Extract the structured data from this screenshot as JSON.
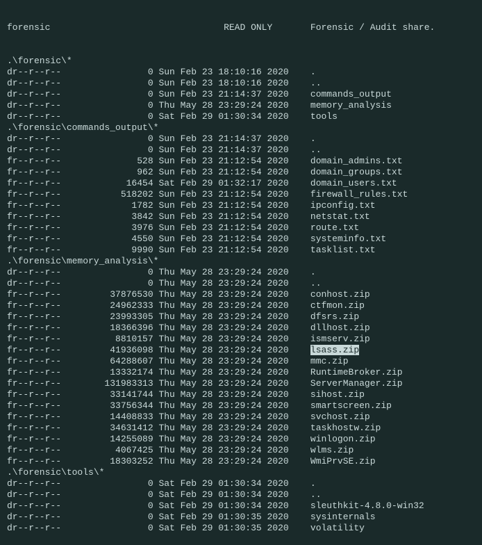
{
  "share": {
    "name": "forensic",
    "permission": "READ ONLY",
    "description": "Forensic / Audit share."
  },
  "sections": [
    {
      "path": ".\\forensic\\*",
      "rows": [
        {
          "perms": "dr--r--r--",
          "size": "0",
          "date": "Sun Feb 23 18:10:16 2020",
          "name": "."
        },
        {
          "perms": "dr--r--r--",
          "size": "0",
          "date": "Sun Feb 23 18:10:16 2020",
          "name": ".."
        },
        {
          "perms": "dr--r--r--",
          "size": "0",
          "date": "Sun Feb 23 21:14:37 2020",
          "name": "commands_output"
        },
        {
          "perms": "dr--r--r--",
          "size": "0",
          "date": "Thu May 28 23:29:24 2020",
          "name": "memory_analysis"
        },
        {
          "perms": "dr--r--r--",
          "size": "0",
          "date": "Sat Feb 29 01:30:34 2020",
          "name": "tools"
        }
      ]
    },
    {
      "path": ".\\forensic\\commands_output\\*",
      "rows": [
        {
          "perms": "dr--r--r--",
          "size": "0",
          "date": "Sun Feb 23 21:14:37 2020",
          "name": "."
        },
        {
          "perms": "dr--r--r--",
          "size": "0",
          "date": "Sun Feb 23 21:14:37 2020",
          "name": ".."
        },
        {
          "perms": "fr--r--r--",
          "size": "528",
          "date": "Sun Feb 23 21:12:54 2020",
          "name": "domain_admins.txt"
        },
        {
          "perms": "fr--r--r--",
          "size": "962",
          "date": "Sun Feb 23 21:12:54 2020",
          "name": "domain_groups.txt"
        },
        {
          "perms": "fr--r--r--",
          "size": "16454",
          "date": "Sat Feb 29 01:32:17 2020",
          "name": "domain_users.txt"
        },
        {
          "perms": "fr--r--r--",
          "size": "518202",
          "date": "Sun Feb 23 21:12:54 2020",
          "name": "firewall_rules.txt"
        },
        {
          "perms": "fr--r--r--",
          "size": "1782",
          "date": "Sun Feb 23 21:12:54 2020",
          "name": "ipconfig.txt"
        },
        {
          "perms": "fr--r--r--",
          "size": "3842",
          "date": "Sun Feb 23 21:12:54 2020",
          "name": "netstat.txt"
        },
        {
          "perms": "fr--r--r--",
          "size": "3976",
          "date": "Sun Feb 23 21:12:54 2020",
          "name": "route.txt"
        },
        {
          "perms": "fr--r--r--",
          "size": "4550",
          "date": "Sun Feb 23 21:12:54 2020",
          "name": "systeminfo.txt"
        },
        {
          "perms": "fr--r--r--",
          "size": "9990",
          "date": "Sun Feb 23 21:12:54 2020",
          "name": "tasklist.txt"
        }
      ]
    },
    {
      "path": ".\\forensic\\memory_analysis\\*",
      "rows": [
        {
          "perms": "dr--r--r--",
          "size": "0",
          "date": "Thu May 28 23:29:24 2020",
          "name": "."
        },
        {
          "perms": "dr--r--r--",
          "size": "0",
          "date": "Thu May 28 23:29:24 2020",
          "name": ".."
        },
        {
          "perms": "fr--r--r--",
          "size": "37876530",
          "date": "Thu May 28 23:29:24 2020",
          "name": "conhost.zip"
        },
        {
          "perms": "fr--r--r--",
          "size": "24962333",
          "date": "Thu May 28 23:29:24 2020",
          "name": "ctfmon.zip"
        },
        {
          "perms": "fr--r--r--",
          "size": "23993305",
          "date": "Thu May 28 23:29:24 2020",
          "name": "dfsrs.zip"
        },
        {
          "perms": "fr--r--r--",
          "size": "18366396",
          "date": "Thu May 28 23:29:24 2020",
          "name": "dllhost.zip"
        },
        {
          "perms": "fr--r--r--",
          "size": "8810157",
          "date": "Thu May 28 23:29:24 2020",
          "name": "ismserv.zip"
        },
        {
          "perms": "fr--r--r--",
          "size": "41936098",
          "date": "Thu May 28 23:29:24 2020",
          "name": "lsass.zip",
          "highlight": true
        },
        {
          "perms": "fr--r--r--",
          "size": "64288607",
          "date": "Thu May 28 23:29:24 2020",
          "name": "mmc.zip"
        },
        {
          "perms": "fr--r--r--",
          "size": "13332174",
          "date": "Thu May 28 23:29:24 2020",
          "name": "RuntimeBroker.zip"
        },
        {
          "perms": "fr--r--r--",
          "size": "131983313",
          "date": "Thu May 28 23:29:24 2020",
          "name": "ServerManager.zip"
        },
        {
          "perms": "fr--r--r--",
          "size": "33141744",
          "date": "Thu May 28 23:29:24 2020",
          "name": "sihost.zip"
        },
        {
          "perms": "fr--r--r--",
          "size": "33756344",
          "date": "Thu May 28 23:29:24 2020",
          "name": "smartscreen.zip"
        },
        {
          "perms": "fr--r--r--",
          "size": "14408833",
          "date": "Thu May 28 23:29:24 2020",
          "name": "svchost.zip"
        },
        {
          "perms": "fr--r--r--",
          "size": "34631412",
          "date": "Thu May 28 23:29:24 2020",
          "name": "taskhostw.zip"
        },
        {
          "perms": "fr--r--r--",
          "size": "14255089",
          "date": "Thu May 28 23:29:24 2020",
          "name": "winlogon.zip"
        },
        {
          "perms": "fr--r--r--",
          "size": "4067425",
          "date": "Thu May 28 23:29:24 2020",
          "name": "wlms.zip"
        },
        {
          "perms": "fr--r--r--",
          "size": "18303252",
          "date": "Thu May 28 23:29:24 2020",
          "name": "WmiPrvSE.zip"
        }
      ]
    },
    {
      "path": ".\\forensic\\tools\\*",
      "rows": [
        {
          "perms": "dr--r--r--",
          "size": "0",
          "date": "Sat Feb 29 01:30:34 2020",
          "name": "."
        },
        {
          "perms": "dr--r--r--",
          "size": "0",
          "date": "Sat Feb 29 01:30:34 2020",
          "name": ".."
        },
        {
          "perms": "dr--r--r--",
          "size": "0",
          "date": "Sat Feb 29 01:30:34 2020",
          "name": "sleuthkit-4.8.0-win32"
        },
        {
          "perms": "dr--r--r--",
          "size": "0",
          "date": "Sat Feb 29 01:30:35 2020",
          "name": "sysinternals"
        },
        {
          "perms": "dr--r--r--",
          "size": "0",
          "date": "Sat Feb 29 01:30:35 2020",
          "name": "volatility"
        }
      ]
    }
  ]
}
